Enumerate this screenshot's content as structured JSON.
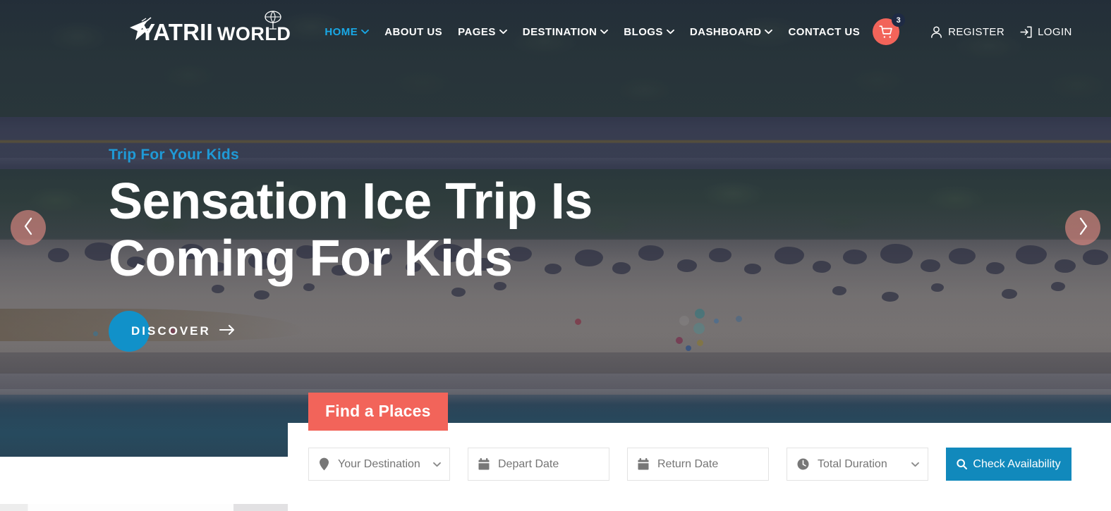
{
  "brand": {
    "name": "YATRII",
    "suffix": "WORLD",
    "plane_icon": "plane-icon",
    "globe_icon": "globe-icon"
  },
  "nav": {
    "items": [
      {
        "label": "HOME",
        "has_caret": true,
        "active": true
      },
      {
        "label": "ABOUT US",
        "has_caret": false,
        "active": false
      },
      {
        "label": "PAGES",
        "has_caret": true,
        "active": false
      },
      {
        "label": "DESTINATION",
        "has_caret": true,
        "active": false
      },
      {
        "label": "BLOGS",
        "has_caret": true,
        "active": false
      },
      {
        "label": "DASHBOARD",
        "has_caret": true,
        "active": false
      },
      {
        "label": "CONTACT US",
        "has_caret": false,
        "active": false
      }
    ],
    "cart": {
      "icon": "shopping-cart-icon",
      "count": "3"
    },
    "auth": [
      {
        "label": "REGISTER",
        "icon": "user-icon"
      },
      {
        "label": "LOGIN",
        "icon": "sign-in-icon"
      }
    ]
  },
  "hero": {
    "eyebrow": "Trip For Your Kids",
    "title_line1": "Sensation Ice Trip Is",
    "title_line2": "Coming For Kids",
    "cta_label": "DISCOVER",
    "cta_arrow_icon": "arrow-right-icon",
    "prev_icon": "chevron-left-icon",
    "next_icon": "chevron-right-icon"
  },
  "search": {
    "tab_label": "Find a Places",
    "fields": [
      {
        "placeholder": "Your Destination",
        "icon": "map-pin-icon",
        "caret": true,
        "value": ""
      },
      {
        "placeholder": "Depart Date",
        "icon": "calendar-icon",
        "caret": false,
        "value": ""
      },
      {
        "placeholder": "Return Date",
        "icon": "calendar-icon",
        "caret": false,
        "value": ""
      },
      {
        "placeholder": "Total Duration",
        "icon": "clock-icon",
        "caret": true,
        "value": ""
      }
    ],
    "submit_label": "Check Availability",
    "submit_icon": "search-icon"
  },
  "colors": {
    "accent_blue": "#1189bc",
    "link_blue": "#19a8e6",
    "coral": "#f2645a",
    "badge_navy": "#1e2a44",
    "panel_white": "#ffffff",
    "placeholder_gray": "#9b9b9b"
  }
}
